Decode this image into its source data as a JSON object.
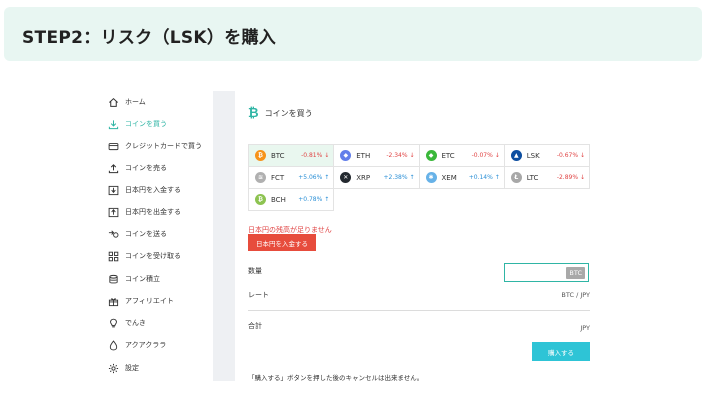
{
  "banner": {
    "title": "STEP2：リスク（LSK）を購入"
  },
  "sidebar": {
    "items": [
      {
        "label": "ホーム",
        "icon": "home-icon"
      },
      {
        "label": "コインを買う",
        "icon": "download-icon",
        "active": true
      },
      {
        "label": "クレジットカードで買う",
        "icon": "credit-card-icon"
      },
      {
        "label": "コインを売る",
        "icon": "upload-icon"
      },
      {
        "label": "日本円を入金する",
        "icon": "bank-deposit-icon"
      },
      {
        "label": "日本円を出金する",
        "icon": "bank-withdraw-icon"
      },
      {
        "label": "コインを送る",
        "icon": "send-icon"
      },
      {
        "label": "コインを受け取る",
        "icon": "receive-icon"
      },
      {
        "label": "コイン積立",
        "icon": "stack-icon"
      },
      {
        "label": "アフィリエイト",
        "icon": "gift-icon"
      },
      {
        "label": "でんき",
        "icon": "bulb-icon"
      },
      {
        "label": "アクアクララ",
        "icon": "water-drop-icon"
      },
      {
        "label": "設定",
        "icon": "gear-icon"
      }
    ]
  },
  "main": {
    "title": "コインを買う",
    "coins": [
      {
        "symbol": "BTC",
        "change": "-0.81%",
        "direction": "down",
        "color": "#f7931a",
        "glyph": "₿",
        "selected": true
      },
      {
        "symbol": "ETH",
        "change": "-2.34%",
        "direction": "down",
        "color": "#627eea",
        "glyph": "◆"
      },
      {
        "symbol": "ETC",
        "change": "-0.07%",
        "direction": "down",
        "color": "#3ab83a",
        "glyph": "◆"
      },
      {
        "symbol": "LSK",
        "change": "-0.67%",
        "direction": "down",
        "color": "#0d4ea0",
        "glyph": "▲"
      },
      {
        "symbol": "FCT",
        "change": "+5.06%",
        "direction": "up",
        "color": "#b0b0b0",
        "glyph": "≋"
      },
      {
        "symbol": "XRP",
        "change": "+2.38%",
        "direction": "up",
        "color": "#23292f",
        "glyph": "✕"
      },
      {
        "symbol": "XEM",
        "change": "+0.14%",
        "direction": "up",
        "color": "#67b2e8",
        "glyph": "✱"
      },
      {
        "symbol": "LTC",
        "change": "-2.89%",
        "direction": "down",
        "color": "#a8a8a8",
        "glyph": "Ł"
      },
      {
        "symbol": "BCH",
        "change": "+0.78%",
        "direction": "up",
        "color": "#8dc351",
        "glyph": "₿"
      }
    ],
    "warning": "日本円の残高が足りません",
    "deposit_button": "日本円を入金する",
    "quantity_label": "数量",
    "quantity_unit": "BTC",
    "rate_label": "レート",
    "rate_value": "BTC / JPY",
    "total_label": "合計",
    "total_unit": "JPY",
    "buy_button": "購入する",
    "note": "「購入する」ボタンを押した後のキャンセルは出来ません。"
  },
  "colors": {
    "accent": "#2fb5a5",
    "danger": "#e74c3c",
    "buy": "#2ec4d6",
    "up": "#2a8fd6",
    "down": "#e04343"
  }
}
